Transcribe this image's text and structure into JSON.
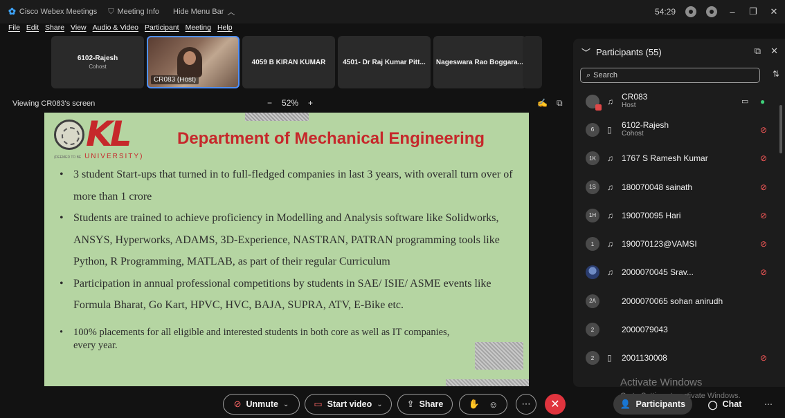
{
  "titlebar": {
    "app_name": "Cisco Webex Meetings",
    "meeting_info": "Meeting Info",
    "hide_menu": "Hide Menu Bar",
    "timer": "54:29"
  },
  "menu": [
    "File",
    "Edit",
    "Share",
    "View",
    "Audio & Video",
    "Participant",
    "Meeting",
    "Help"
  ],
  "strip": {
    "tiles": [
      {
        "name": "6102-Rajesh",
        "role": "Cohost"
      },
      {
        "name": "CR083 (Host)",
        "role": ""
      },
      {
        "name": "4059 B KIRAN KUMAR",
        "role": ""
      },
      {
        "name": "4501- Dr Raj Kumar Pitt...",
        "role": ""
      },
      {
        "name": "Nageswara Rao Boggara...",
        "role": ""
      }
    ]
  },
  "viewbar": {
    "label": "Viewing CR083's screen",
    "zoom_minus": "−",
    "zoom_level": "52%",
    "zoom_plus": "+"
  },
  "slide": {
    "logo_text": "KL",
    "university": "UNIVERSITY)",
    "deemed": "(DEEMED TO BE",
    "title": "Department of Mechanical Engineering",
    "bullets": [
      "3 student Start-ups that turned in to full-fledged companies in last 3 years, with overall turn over of more than 1 crore",
      "Students are trained to achieve proficiency in Modelling and Analysis software like Solidworks, ANSYS, Hyperworks, ADAMS, 3D-Experience, NASTRAN, PATRAN programming tools like Python, R Programming, MATLAB, as part of their regular Curriculum",
      "Participation in annual professional competitions by students in SAE/ ISIE/ ASME events like Formula Bharat, Go Kart, HPVC, HVC, BAJA, SUPRA, ATV, E-Bike etc.",
      "100% placements for all eligible and interested students in both core as well as IT companies, every year."
    ]
  },
  "panel": {
    "title": "Participants (55)",
    "search_placeholder": "Search",
    "participants": [
      {
        "avatar": "",
        "name": "CR083",
        "role": "Host",
        "device": "headset",
        "mic": "on"
      },
      {
        "avatar": "6",
        "name": "6102-Rajesh",
        "role": "Cohost",
        "device": "phone",
        "mic": "off"
      },
      {
        "avatar": "1K",
        "name": "1767 S Ramesh Kumar",
        "role": "",
        "device": "headset",
        "mic": "off"
      },
      {
        "avatar": "1S",
        "name": "180070048 sainath",
        "role": "",
        "device": "headset",
        "mic": "off"
      },
      {
        "avatar": "1H",
        "name": "190070095 Hari",
        "role": "",
        "device": "headset",
        "mic": "off"
      },
      {
        "avatar": "1",
        "name": "190070123@VAMSI",
        "role": "",
        "device": "headset",
        "mic": "off"
      },
      {
        "avatar": "",
        "name": "2000070045 Srav...",
        "role": "",
        "device": "headset",
        "mic": "off"
      },
      {
        "avatar": "2A",
        "name": "2000070065 sohan anirudh",
        "role": "",
        "device": "",
        "mic": ""
      },
      {
        "avatar": "2",
        "name": "2000079043",
        "role": "",
        "device": "",
        "mic": ""
      },
      {
        "avatar": "2",
        "name": "2001130008",
        "role": "",
        "device": "phone",
        "mic": "off"
      }
    ]
  },
  "watermark": {
    "line1": "Activate Windows",
    "line2": "Go to Settings to activate Windows."
  },
  "bottombar": {
    "unmute": "Unmute",
    "start_video": "Start video",
    "share": "Share",
    "participants": "Participants",
    "chat": "Chat"
  }
}
